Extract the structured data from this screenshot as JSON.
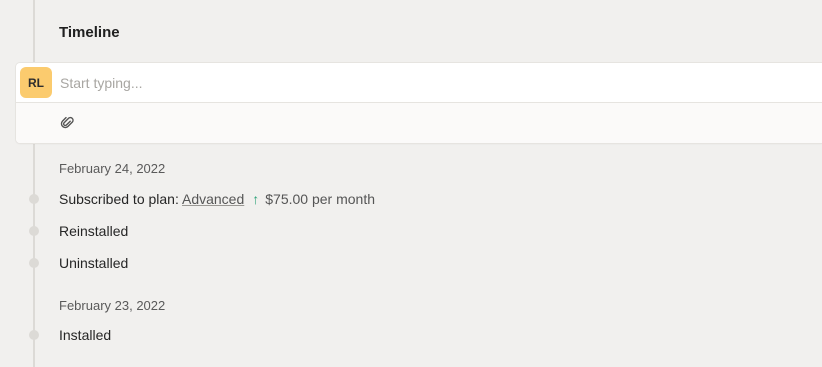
{
  "timeline": {
    "title": "Timeline"
  },
  "composer": {
    "avatar_initials": "RL",
    "avatar_color": "#fbcb6e",
    "placeholder": "Start typing...",
    "attach_icon": "paperclip-icon"
  },
  "groups": [
    {
      "date": "February 24, 2022",
      "events": [
        {
          "prefix": "Subscribed to plan: ",
          "link": "Advanced",
          "arrow": "↑",
          "arrow_color": "#2fa37a",
          "price": "$75.00 per month"
        },
        {
          "label": "Reinstalled"
        },
        {
          "label": "Uninstalled"
        }
      ]
    },
    {
      "date": "February 23, 2022",
      "events": [
        {
          "label": "Installed"
        }
      ]
    }
  ]
}
